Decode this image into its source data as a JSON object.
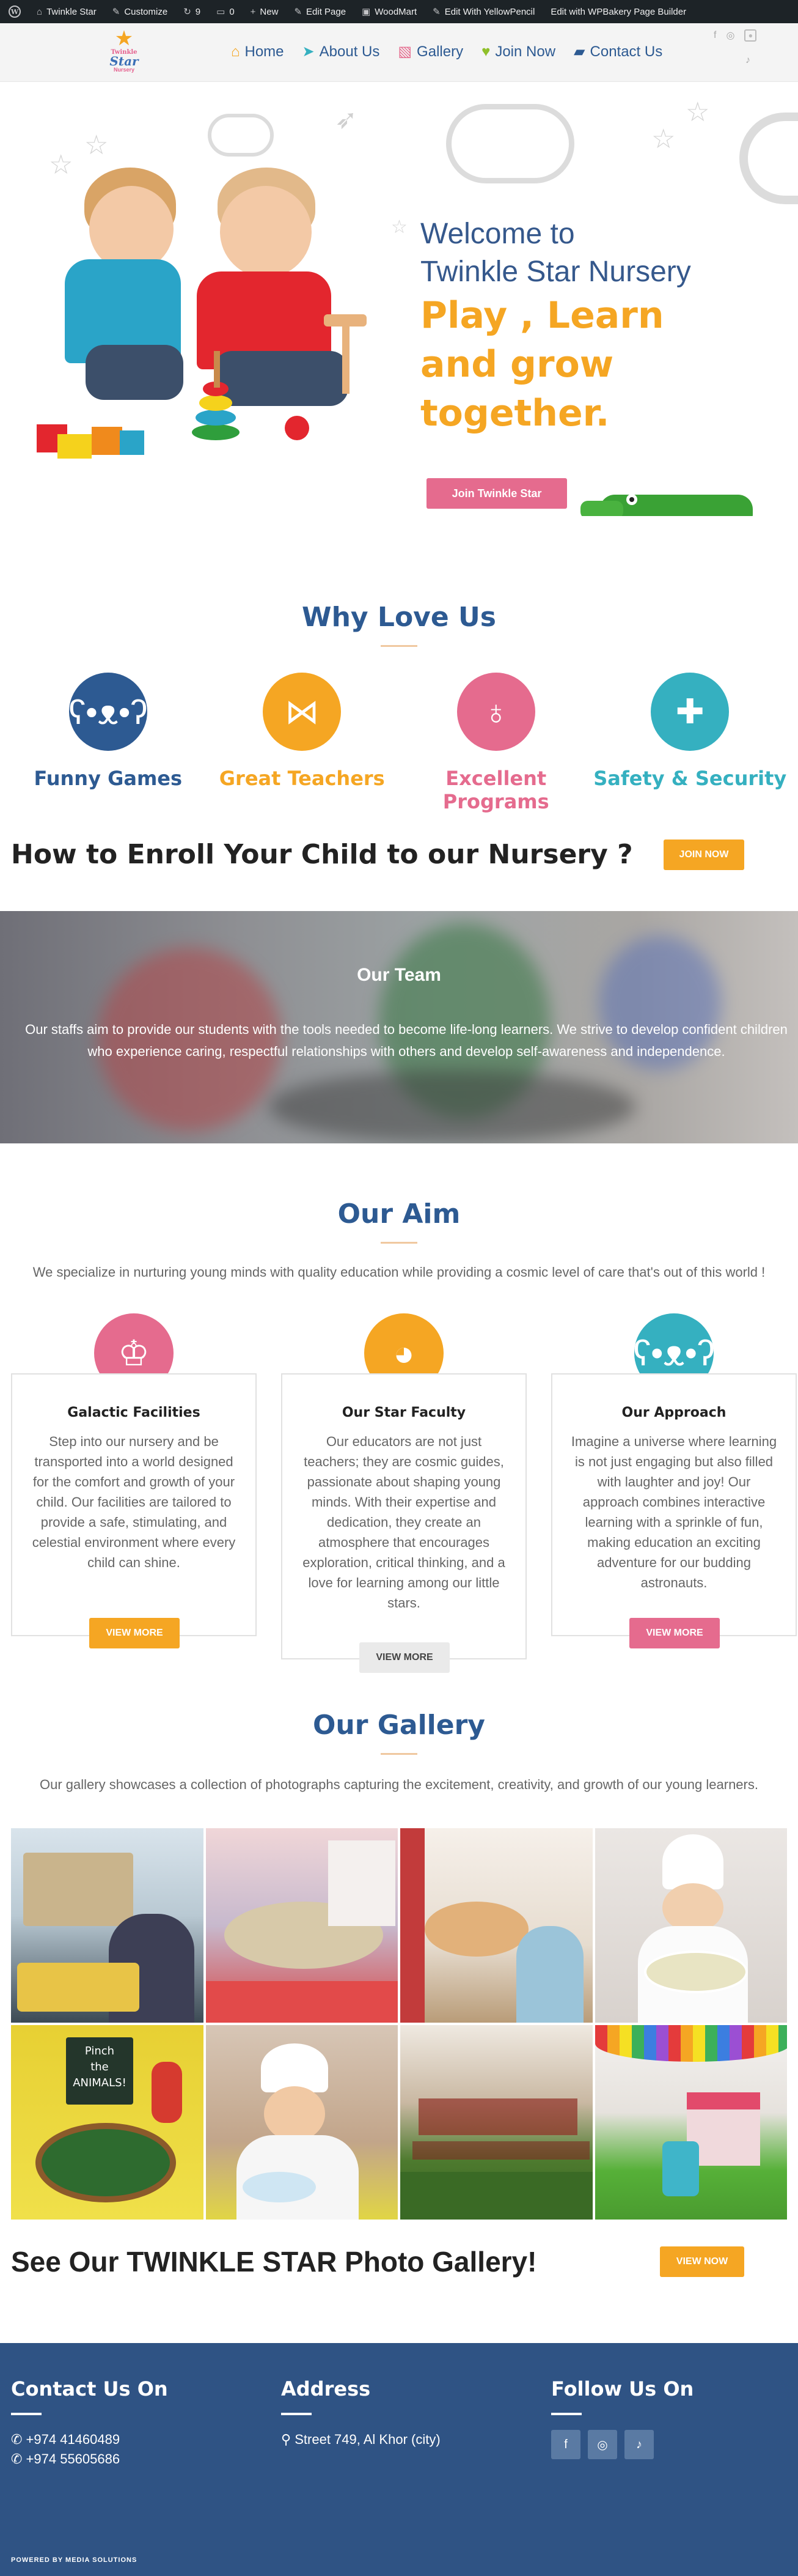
{
  "adminbar": {
    "items": [
      "Twinkle Star",
      "Customize",
      "9",
      "0",
      "New",
      "Edit Page",
      "WoodMart",
      "Edit With YellowPencil",
      "Edit with WPBakery Page Builder"
    ]
  },
  "logo": {
    "line1": "Twinkle",
    "line2": "Star",
    "line3": "Nursery"
  },
  "nav": {
    "items": [
      "Home",
      "About Us",
      "Gallery",
      "Join Now",
      "Contact Us"
    ]
  },
  "hero": {
    "welcome_line1": "Welcome to",
    "welcome_line2": "Twinkle Star Nursery",
    "tagline_line1": "Play , Learn",
    "tagline_line2": "and grow together.",
    "button": "Join Twinkle Star"
  },
  "why": {
    "title": "Why Love Us",
    "features": [
      {
        "label": "Funny Games",
        "color": "#2d5a92",
        "icon": "teddy-bear-icon"
      },
      {
        "label": "Great Teachers",
        "color": "#f5a623",
        "icon": "bow-tie-icon"
      },
      {
        "label": "Excellent Programs",
        "color": "#e56b8e",
        "icon": "rattle-icon"
      },
      {
        "label": "Safety & Security",
        "color": "#35b0c0",
        "icon": "baby-monitor-icon"
      }
    ]
  },
  "enroll": {
    "title": "How to Enroll Your Child to our Nursery ?",
    "button": "JOIN NOW"
  },
  "team": {
    "title": "Our Team",
    "text": "Our staffs aim to provide our students with the tools needed to become life-long learners. We strive to develop confident children who experience caring, respectful relationships with others and develop self-awareness and independence."
  },
  "aim": {
    "title": "Our Aim",
    "intro": "We specialize in nurturing young minds with quality education while providing a cosmic level of care that's out of this world !",
    "cards": [
      {
        "title": "Galactic Facilities",
        "text": "Step into our nursery and be transported into a world designed for the comfort and growth of your child. Our facilities are tailored to provide a safe, stimulating, and celestial environment where every child can shine.",
        "button": "VIEW MORE",
        "color": "#e56b8e",
        "icon": "onesie-icon",
        "button_color": "#f5a623"
      },
      {
        "title": "Our Star Faculty",
        "text": "Our educators are not just teachers; they are cosmic guides, passionate about shaping young minds. With their expertise and dedication, they create an atmosphere that encourages exploration, critical thinking, and a love for learning among our little stars.",
        "button": "VIEW MORE",
        "color": "#f5a623",
        "icon": "duck-icon",
        "button_color": "#eaeaea"
      },
      {
        "title": "Our Approach",
        "text": "Imagine a universe where learning is not just engaging but also filled with laughter and joy! Our approach combines interactive learning with a sprinkle of fun, making education an exciting adventure for our budding astronauts.",
        "button": "VIEW MORE",
        "color": "#35b0c0",
        "icon": "teddy-bear-icon",
        "button_color": "#e56b8e"
      }
    ]
  },
  "gallery": {
    "title": "Our Gallery",
    "intro": "Our gallery showcases a collection of photographs capturing the excitement, creativity, and growth of our young learners.",
    "photo_sign": [
      "Pinch",
      "the",
      "ANIMALS!"
    ]
  },
  "see_gallery": {
    "title": "See Our TWINKLE STAR Photo Gallery!",
    "button": "VIEW NOW"
  },
  "footer": {
    "contact_head": "Contact Us On",
    "phone1": "+974 41460489",
    "phone2": "+974 55605686",
    "address_head": "Address",
    "address": "Street 749, Al Khor (city)",
    "follow_head": "Follow Us On",
    "powered": "POWERED BY MEDIA SOLUTIONS"
  }
}
